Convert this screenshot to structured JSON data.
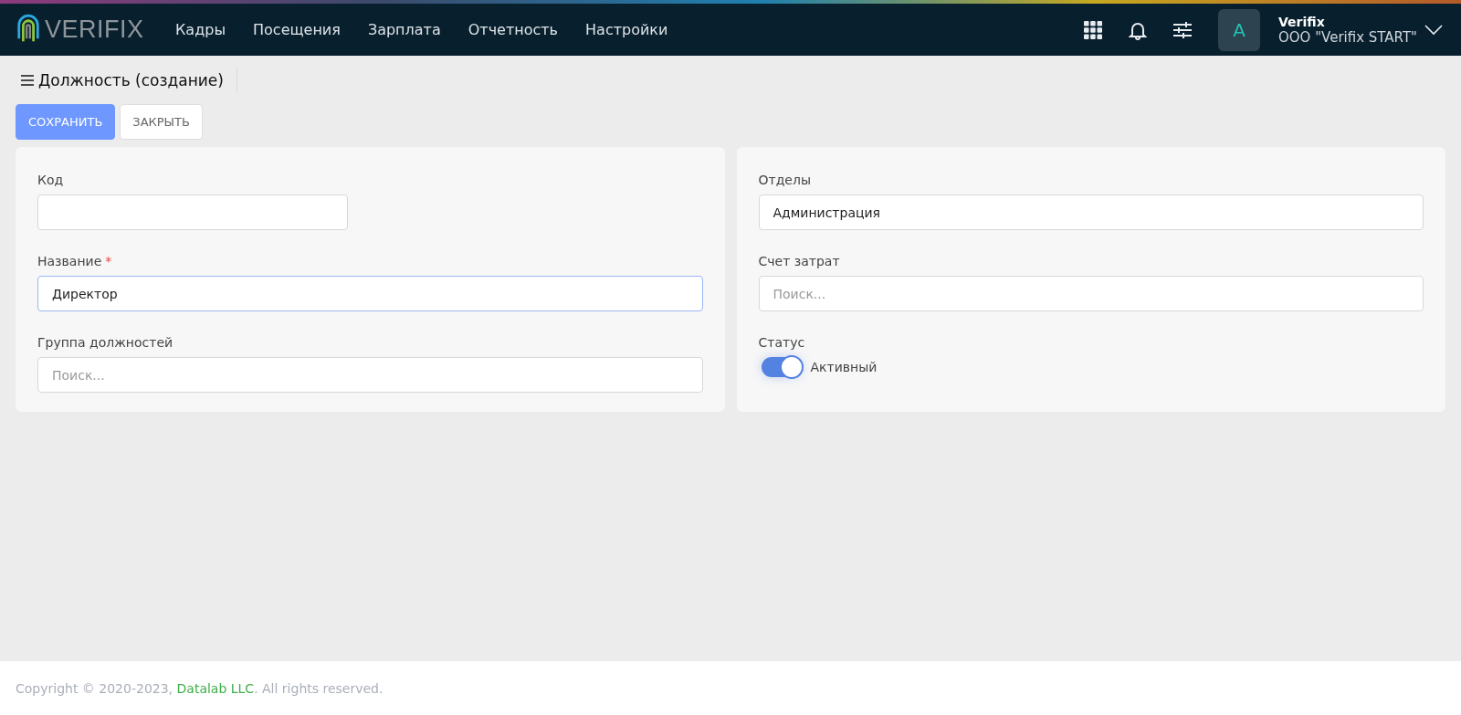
{
  "header": {
    "logo_text": "VERIFIX",
    "menu": [
      {
        "label": "Кадры",
        "selected": false
      },
      {
        "label": "Посещения",
        "selected": false
      },
      {
        "label": "Зарплата",
        "selected": false
      },
      {
        "label": "Отчетность",
        "selected": false
      },
      {
        "label": "Настройки",
        "selected": false
      }
    ],
    "user": {
      "avatar_letter": "A",
      "name": "Verifix",
      "company": "OOO \"Verifix START\""
    }
  },
  "page": {
    "title": "Должность (создание)",
    "buttons": [
      {
        "label": "СОХРАНИТЬ",
        "kind": "primary"
      },
      {
        "label": "ЗАКРЫТЬ",
        "kind": "secondary"
      }
    ]
  },
  "form_left": [
    {
      "kind": "short_field",
      "label": "Код",
      "focused": false
    },
    {
      "kind": "field",
      "label": "Название",
      "required_mark": "*",
      "value": "Директор",
      "focused": true
    },
    {
      "kind": "field",
      "label": "Группа должностей",
      "placeholder": "Поиск...",
      "focused": false
    }
  ],
  "form_right": [
    {
      "kind": "field",
      "label": "Отделы",
      "value": "Администрация",
      "focused": false
    },
    {
      "kind": "field",
      "label": "Счет затрат",
      "placeholder": "Поиск...",
      "focused": false
    },
    {
      "kind": "switch",
      "label": "Статус",
      "on": true,
      "text": "Активный"
    }
  ],
  "footer": {
    "prefix": "Copyright © 2020-2023, ",
    "link": "Datalab LLC",
    "suffix": ". All rights reserved."
  }
}
